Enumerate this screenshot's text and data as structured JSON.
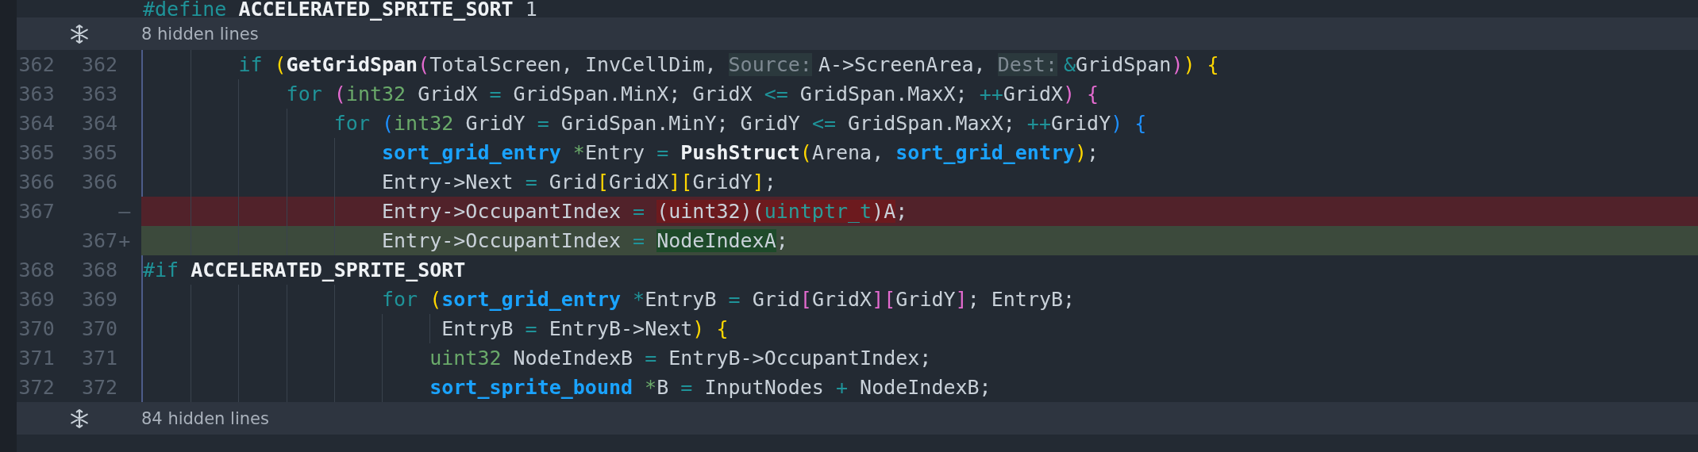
{
  "lead_line": {
    "tokens": [
      {
        "text": "#define",
        "kind": "pre"
      },
      {
        "text": " ACCELERATED_SPRITE_SORT",
        "kind": "fn"
      },
      {
        "text": " 1",
        "kind": "plain"
      }
    ]
  },
  "hidden_top": {
    "label": "8 hidden lines"
  },
  "lines": [
    {
      "old": "362",
      "new": "362",
      "kind": "context",
      "tokens": [
        {
          "text": "        if",
          "kind": "kw"
        },
        {
          "text": " (",
          "kind": "p1"
        },
        {
          "text": "GetGridSpan",
          "kind": "fn"
        },
        {
          "text": "(",
          "kind": "p2"
        },
        {
          "text": "TotalScreen, InvCellDim, ",
          "kind": "plain"
        },
        {
          "text": "Source:",
          "kind": "hint"
        },
        {
          "text": "A->ScreenArea, ",
          "kind": "plain"
        },
        {
          "text": "Dest:",
          "kind": "hint"
        },
        {
          "text": "&",
          "kind": "op"
        },
        {
          "text": "GridSpan",
          "kind": "plain"
        },
        {
          "text": ")",
          "kind": "p2"
        },
        {
          "text": ")",
          "kind": "p1"
        },
        {
          "text": " {",
          "kind": "p1"
        }
      ]
    },
    {
      "old": "363",
      "new": "363",
      "kind": "context",
      "tokens": [
        {
          "text": "            for",
          "kind": "kw"
        },
        {
          "text": " (",
          "kind": "p2"
        },
        {
          "text": "int32",
          "kind": "type"
        },
        {
          "text": " GridX ",
          "kind": "plain"
        },
        {
          "text": "=",
          "kind": "op"
        },
        {
          "text": " GridSpan.MinX; GridX ",
          "kind": "plain"
        },
        {
          "text": "<=",
          "kind": "op"
        },
        {
          "text": " GridSpan.MaxX; ",
          "kind": "plain"
        },
        {
          "text": "++",
          "kind": "op"
        },
        {
          "text": "GridX",
          "kind": "plain"
        },
        {
          "text": ")",
          "kind": "p2"
        },
        {
          "text": " {",
          "kind": "p2"
        }
      ]
    },
    {
      "old": "364",
      "new": "364",
      "kind": "context",
      "tokens": [
        {
          "text": "                for",
          "kind": "kw"
        },
        {
          "text": " (",
          "kind": "p3"
        },
        {
          "text": "int32",
          "kind": "type"
        },
        {
          "text": " GridY ",
          "kind": "plain"
        },
        {
          "text": "=",
          "kind": "op"
        },
        {
          "text": " GridSpan.MinY; GridY ",
          "kind": "plain"
        },
        {
          "text": "<=",
          "kind": "op"
        },
        {
          "text": " GridSpan.MaxX; ",
          "kind": "plain"
        },
        {
          "text": "++",
          "kind": "op"
        },
        {
          "text": "GridY",
          "kind": "plain"
        },
        {
          "text": ")",
          "kind": "p3"
        },
        {
          "text": " {",
          "kind": "p3"
        }
      ]
    },
    {
      "old": "365",
      "new": "365",
      "kind": "context",
      "tokens": [
        {
          "text": "                    sort_grid_entry",
          "kind": "struct"
        },
        {
          "text": " *",
          "kind": "star"
        },
        {
          "text": "Entry ",
          "kind": "plain"
        },
        {
          "text": "=",
          "kind": "op"
        },
        {
          "text": " PushStruct",
          "kind": "fn"
        },
        {
          "text": "(",
          "kind": "p1"
        },
        {
          "text": "Arena, ",
          "kind": "plain"
        },
        {
          "text": "sort_grid_entry",
          "kind": "struct"
        },
        {
          "text": ")",
          "kind": "p1"
        },
        {
          "text": ";",
          "kind": "plain"
        }
      ]
    },
    {
      "old": "366",
      "new": "366",
      "kind": "context",
      "tokens": [
        {
          "text": "                    Entry->Next ",
          "kind": "plain"
        },
        {
          "text": "=",
          "kind": "op"
        },
        {
          "text": " Grid",
          "kind": "plain"
        },
        {
          "text": "[",
          "kind": "p1"
        },
        {
          "text": "GridX",
          "kind": "plain"
        },
        {
          "text": "]",
          "kind": "p1"
        },
        {
          "text": "[",
          "kind": "p1"
        },
        {
          "text": "GridY",
          "kind": "plain"
        },
        {
          "text": "]",
          "kind": "p1"
        },
        {
          "text": ";",
          "kind": "plain"
        }
      ]
    },
    {
      "old": "367",
      "marker": "—",
      "kind": "removed",
      "tokens": [
        {
          "text": "                    Entry->OccupantIndex ",
          "kind": "plain"
        },
        {
          "text": "= ",
          "kind": "op"
        },
        {
          "text": "(uint32)(",
          "kind": "del"
        },
        {
          "text": "uintptr_t",
          "kind": "del-type"
        },
        {
          "text": ")A",
          "kind": "del"
        },
        {
          "text": ";",
          "kind": "plain"
        }
      ]
    },
    {
      "new": "367",
      "marker": "+",
      "kind": "added",
      "tokens": [
        {
          "text": "                    Entry->OccupantIndex ",
          "kind": "plain"
        },
        {
          "text": "= ",
          "kind": "op"
        },
        {
          "text": "NodeIndexA",
          "kind": "ins"
        },
        {
          "text": ";",
          "kind": "plain"
        }
      ]
    },
    {
      "old": "368",
      "new": "368",
      "kind": "context",
      "tokens": [
        {
          "text": "#if",
          "kind": "pre"
        },
        {
          "text": " ACCELERATED_SPRITE_SORT",
          "kind": "fn"
        }
      ]
    },
    {
      "old": "369",
      "new": "369",
      "kind": "context",
      "tokens": [
        {
          "text": "                    for",
          "kind": "kw"
        },
        {
          "text": " (",
          "kind": "p1"
        },
        {
          "text": "sort_grid_entry",
          "kind": "struct"
        },
        {
          "text": " *",
          "kind": "op"
        },
        {
          "text": "EntryB ",
          "kind": "plain"
        },
        {
          "text": "=",
          "kind": "op"
        },
        {
          "text": " Grid",
          "kind": "plain"
        },
        {
          "text": "[",
          "kind": "p2"
        },
        {
          "text": "GridX",
          "kind": "plain"
        },
        {
          "text": "]",
          "kind": "p2"
        },
        {
          "text": "[",
          "kind": "p2"
        },
        {
          "text": "GridY",
          "kind": "plain"
        },
        {
          "text": "]",
          "kind": "p2"
        },
        {
          "text": "; EntryB;",
          "kind": "plain"
        }
      ]
    },
    {
      "old": "370",
      "new": "370",
      "kind": "context",
      "tokens": [
        {
          "text": "                         EntryB ",
          "kind": "plain"
        },
        {
          "text": "=",
          "kind": "op"
        },
        {
          "text": " EntryB->Next",
          "kind": "plain"
        },
        {
          "text": ")",
          "kind": "p1"
        },
        {
          "text": " {",
          "kind": "p1"
        }
      ]
    },
    {
      "old": "371",
      "new": "371",
      "kind": "context",
      "tokens": [
        {
          "text": "                        uint32",
          "kind": "type"
        },
        {
          "text": " NodeIndexB ",
          "kind": "plain"
        },
        {
          "text": "=",
          "kind": "op"
        },
        {
          "text": " EntryB->OccupantIndex;",
          "kind": "plain"
        }
      ]
    },
    {
      "old": "372",
      "new": "372",
      "kind": "context",
      "tokens": [
        {
          "text": "                        sort_sprite_bound",
          "kind": "struct"
        },
        {
          "text": " *",
          "kind": "star"
        },
        {
          "text": "B ",
          "kind": "plain"
        },
        {
          "text": "=",
          "kind": "op"
        },
        {
          "text": " InputNodes ",
          "kind": "plain"
        },
        {
          "text": "+",
          "kind": "op"
        },
        {
          "text": " NodeIndexB;",
          "kind": "plain"
        }
      ]
    }
  ],
  "hidden_bottom": {
    "label": "84 hidden lines"
  }
}
